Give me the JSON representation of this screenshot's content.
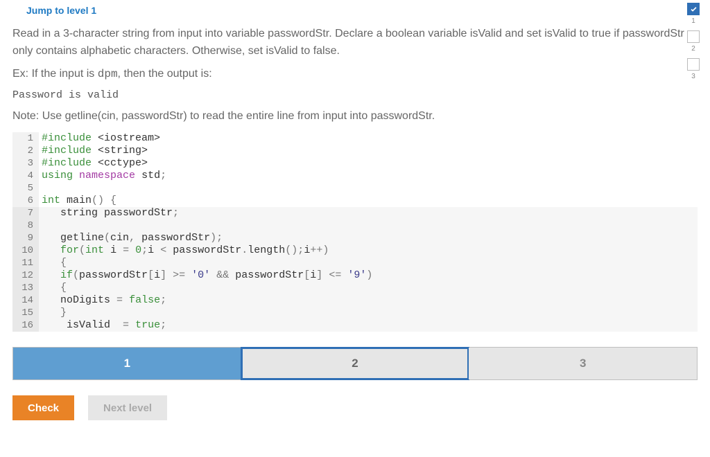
{
  "jump_link": "Jump to level 1",
  "description_1": "Read in a 3-character string from input into variable passwordStr. Declare a boolean variable isValid and set isValid to true if passwordStr only contains alphabetic characters. Otherwise, set isValid to false.",
  "ex_prefix": "Ex: If the input is ",
  "ex_input": "dpm",
  "ex_suffix": ", then the output is:",
  "output_line": "Password is valid",
  "note_line": "Note: Use getline(cin, passwordStr) to read the entire line from input into passwordStr.",
  "code": {
    "1": {
      "raw": "#include <iostream>"
    },
    "2": {
      "raw": "#include <string>"
    },
    "3": {
      "raw": "#include <cctype>"
    },
    "4": {
      "raw": "using namespace std;"
    },
    "5": {
      "raw": ""
    },
    "6": {
      "raw": "int main() {"
    },
    "7": {
      "raw": "   string passwordStr;"
    },
    "8": {
      "raw": ""
    },
    "9": {
      "raw": "   getline(cin, passwordStr);"
    },
    "10": {
      "raw": "   for(int i = 0;i < passwordStr.length();i++)"
    },
    "11": {
      "raw": "   {"
    },
    "12": {
      "raw": "   if(passwordStr[i] >= '0' && passwordStr[i] <= '9')"
    },
    "13": {
      "raw": "   {"
    },
    "14": {
      "raw": "   noDigits = false;"
    },
    "15": {
      "raw": "   }"
    },
    "16": {
      "raw": "    isValid  = true;"
    }
  },
  "pager": {
    "p1": "1",
    "p2": "2",
    "p3": "3"
  },
  "buttons": {
    "check": "Check",
    "next": "Next level"
  },
  "progress": {
    "s1": "1",
    "s2": "2",
    "s3": "3"
  }
}
